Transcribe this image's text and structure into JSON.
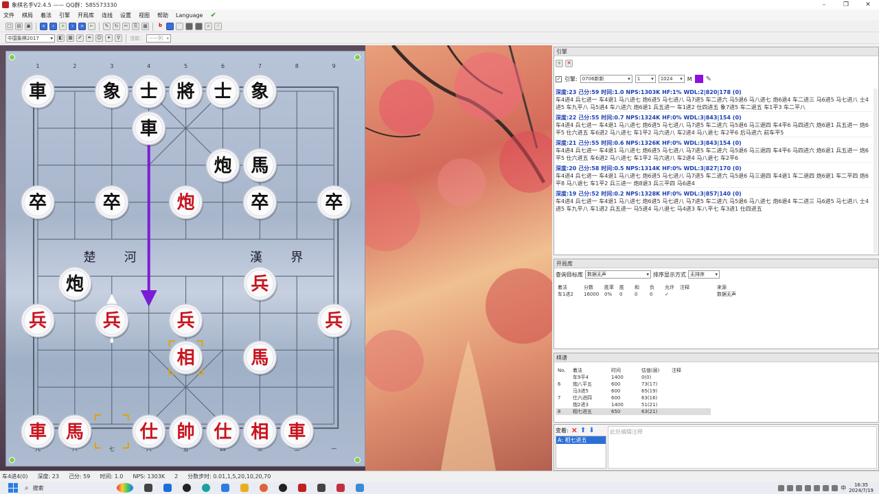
{
  "window": {
    "title": "象棋名手V2.4.5 —— QQ群：585573330",
    "controls": {
      "minimize": "–",
      "restore": "❐",
      "close": "✕"
    }
  },
  "menu": [
    "文件",
    "棋局",
    "着法",
    "引擎",
    "开局库",
    "连线",
    "设置",
    "视图",
    "帮助",
    "Language"
  ],
  "toolbar": {
    "opening_select": "中国象棋2017",
    "current_label": "当前：",
    "current_value": "一一列"
  },
  "board": {
    "top_files": [
      "1",
      "2",
      "3",
      "4",
      "5",
      "6",
      "7",
      "8",
      "9"
    ],
    "bottom_files": [
      "九",
      "八",
      "七",
      "六",
      "五",
      "四",
      "三",
      "二",
      "一"
    ],
    "river": [
      "楚",
      "河",
      "漢",
      "界"
    ]
  },
  "pieces": [
    {
      "char": "車",
      "color": "black",
      "file": 0,
      "rank": 0
    },
    {
      "char": "象",
      "color": "black",
      "file": 2,
      "rank": 0
    },
    {
      "char": "士",
      "color": "black",
      "file": 3,
      "rank": 0
    },
    {
      "char": "將",
      "color": "black",
      "file": 4,
      "rank": 0
    },
    {
      "char": "士",
      "color": "black",
      "file": 5,
      "rank": 0
    },
    {
      "char": "象",
      "color": "black",
      "file": 6,
      "rank": 0
    },
    {
      "char": "車",
      "color": "black",
      "file": 3,
      "rank": 1
    },
    {
      "char": "炮",
      "color": "black",
      "file": 5,
      "rank": 2
    },
    {
      "char": "馬",
      "color": "black",
      "file": 6,
      "rank": 2
    },
    {
      "char": "卒",
      "color": "black",
      "file": 0,
      "rank": 3
    },
    {
      "char": "卒",
      "color": "black",
      "file": 2,
      "rank": 3
    },
    {
      "char": "炮",
      "color": "red",
      "file": 4,
      "rank": 3
    },
    {
      "char": "卒",
      "color": "black",
      "file": 6,
      "rank": 3
    },
    {
      "char": "卒",
      "color": "black",
      "file": 8,
      "rank": 3
    },
    {
      "char": "炮",
      "color": "black",
      "file": 1,
      "rank": 5.2
    },
    {
      "char": "兵",
      "color": "red",
      "file": 6,
      "rank": 5.2
    },
    {
      "char": "兵",
      "color": "red",
      "file": 0,
      "rank": 6.2
    },
    {
      "char": "兵",
      "color": "red",
      "file": 2,
      "rank": 6.2
    },
    {
      "char": "兵",
      "color": "red",
      "file": 4,
      "rank": 6.2
    },
    {
      "char": "兵",
      "color": "red",
      "file": 8,
      "rank": 6.2
    },
    {
      "char": "相",
      "color": "red",
      "file": 4,
      "rank": 7.2
    },
    {
      "char": "馬",
      "color": "red",
      "file": 6,
      "rank": 7.2
    },
    {
      "char": "車",
      "color": "red",
      "file": 0,
      "rank": 9.2
    },
    {
      "char": "馬",
      "color": "red",
      "file": 1,
      "rank": 9.2
    },
    {
      "char": "仕",
      "color": "red",
      "file": 3,
      "rank": 9.2
    },
    {
      "char": "帥",
      "color": "red",
      "file": 4,
      "rank": 9.2
    },
    {
      "char": "仕",
      "color": "red",
      "file": 5,
      "rank": 9.2
    },
    {
      "char": "相",
      "color": "red",
      "file": 6,
      "rank": 9.2
    },
    {
      "char": "車",
      "color": "red",
      "file": 7,
      "rank": 9.2
    }
  ],
  "engine": {
    "header": "引擎",
    "engine_label": "引擎:",
    "engine_name": "0706新新",
    "threads": "1",
    "hash": "1024",
    "hash_unit": "M",
    "lines": [
      {
        "head": "深度:23  己分:59  时间:1.0  NPS:1303K HF:1% WDL:2|820|178 (0)",
        "pv": "车4进4 兵七进一 车4退1 马八进七 炮6进5 马七进八 马7进5 车二进六 马5退6 马八进七 炮6退4 车二进三 马6进5 马七进八 士4进5 车九平八 马5进4 车八进六 炮6退1 兵五进一 车1进2 仕四进五 象7进5 车二退五 车1平3 车二平八"
      },
      {
        "head": "深度:22  己分:55  时间:0.7  NPS:1324K HF:0% WDL:3|843|154 (0)",
        "pv": "车4进4 兵七进一 车4退1 马八进七 炮6进5 马七进八 马7进5 车二进六 马5退6 马三退四 车4平6 马四进六 炮6退1 兵五进一 炮6平5 仕六进五 车6进2 马八进七 车1平2 马六进八 车2进4 马八退七 车2平6 后马进六 前车平5"
      },
      {
        "head": "深度:21  己分:55  时间:0.6  NPS:1326K HF:0% WDL:3|843|154 (0)",
        "pv": "车4进4 兵七进一 车4退1 马八进七 炮6进5 马七进八 马7进5 车二进六 马5退6 马三退四 车4平6 马四进六 炮6退1 兵五进一 炮6平5 仕六进五 车6进2 马八进七 车1平2 马六进八 车2进4 马八退七 车2平6"
      },
      {
        "head": "深度:20  己分:58  时间:0.5  NPS:1314K HF:0% WDL:3|827|170 (0)",
        "pv": "车4进4 兵七进一 车4退1 马八进七 炮6进5 马七进八 马7进5 车二进六 马5退6 马三退四 车4退1 车二退四 炮6退1 车二平四 炮6平8 马八退七 车1平2 兵三进一 炮8退3 兵三平四 马6进4"
      },
      {
        "head": "深度:19  己分:52  时间:0.2  NPS:1328K HF:0% WDL:3|857|140 (0)",
        "pv": "车4进4 兵七进一 车4退1 马八进七 炮6进5 马七进八 马7进5 车二进六 马5退6 马八进七 炮6退4 车二进三 马6进5 马七进八 士4进5 车九平八 车1进2 兵五进一 马5进4 马八退七 马4进3 车八平七 车3进1 仕四进五"
      }
    ]
  },
  "book": {
    "header": "开局库",
    "source_label": "查询目标库",
    "source_value": "数据无声",
    "sort_label": "排序显示方式",
    "sort_value": "无排序",
    "columns": [
      "着法",
      "分数",
      "胜率",
      "胜",
      "和",
      "负",
      "允许",
      "注释",
      "来源"
    ],
    "rows": [
      [
        "车1进2",
        "16000",
        "0%",
        "0",
        "0",
        "0",
        "✓",
        "",
        "数据无声"
      ]
    ]
  },
  "record": {
    "header": "棋谱",
    "columns": [
      "No.",
      "着法",
      "时间",
      "估值(层)",
      "注释"
    ],
    "rows": [
      [
        "",
        "车9平4",
        "1400",
        "0(0)",
        ""
      ],
      [
        "6",
        "炮八平五",
        "600",
        "73(17)",
        ""
      ],
      [
        "",
        "马3进5",
        "600",
        "65(19)",
        ""
      ],
      [
        "7",
        "仕六进四",
        "600",
        "63(16)",
        ""
      ],
      [
        "",
        "炮2进3",
        "1400",
        "51(21)",
        ""
      ],
      [
        "8",
        "相七进五",
        "650",
        "63(21)",
        ""
      ]
    ],
    "variation_label": "变着:",
    "variation_item": "A: 相七进五",
    "comment_placeholder": "此处编辑注释"
  },
  "status": [
    "车4进4(0)",
    "深度: 23",
    "己分: 59",
    "时间: 1.0",
    "NPS: 1303K",
    "2",
    "分数步时: 0.01,1,5,20,10,20,70"
  ],
  "taskbar": {
    "search_placeholder": "搜索",
    "ime": "中",
    "time": "16:35",
    "date": "2024/7/19"
  },
  "colors": {
    "red_piece": "#c8141e",
    "black_piece": "#111111",
    "arrow": "#7a1cd6",
    "highlight": "#e0a200",
    "engine_text": "#1a3fb4"
  }
}
